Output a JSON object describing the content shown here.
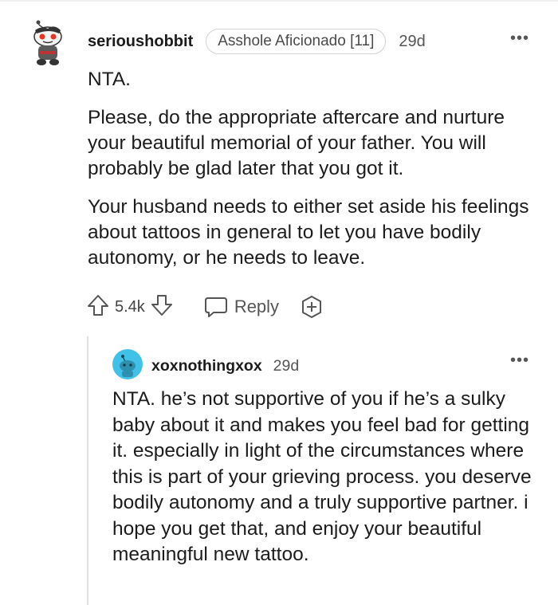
{
  "parent": {
    "username": "serioushobbit",
    "flair": "Asshole Aficionado [11]",
    "age": "29d",
    "more": "•••",
    "paragraphs": [
      "NTA.",
      "Please, do the appropriate aftercare and nurture your beautiful memorial of your father. You will probably be glad later that you got it.",
      "Your husband needs to either set aside his feelings about tattoos in general to let you have bodily autonomy, or he needs to leave."
    ],
    "votes": "5.4k",
    "reply_label": "Reply"
  },
  "reply": {
    "username": "xoxnothingxox",
    "age": "29d",
    "more": "•••",
    "text": "NTA. he’s not supportive of you if he’s a sulky baby about it and makes you feel bad for getting it. especially in light of the circumstances where this is part of your grieving process. you deserve bodily autonomy and a truly supportive partner. i hope you get that, and enjoy your beautiful meaningful new tattoo."
  },
  "colors": {
    "text": "#1c1c1c",
    "muted": "#555555",
    "border": "#cfd2d6",
    "reply_avatar": "#3fc1e8",
    "parent_avatar_accent": "#e8351f"
  },
  "icons": [
    "upvote-icon",
    "downvote-icon",
    "comment-icon",
    "award-icon",
    "more-icon"
  ]
}
